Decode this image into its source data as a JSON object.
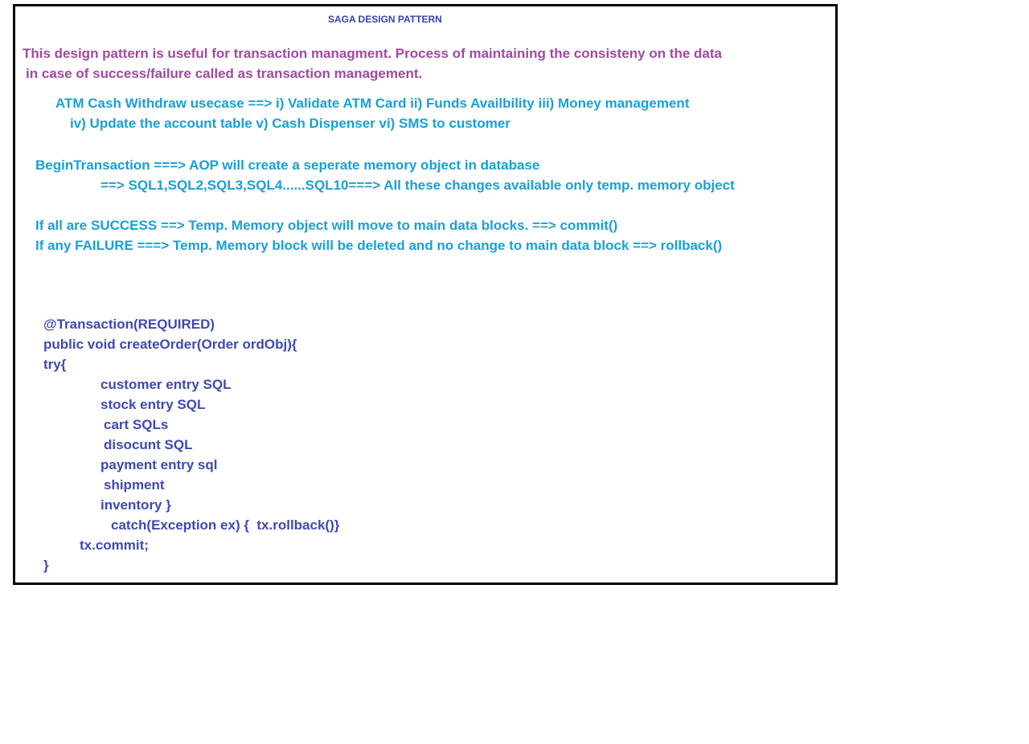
{
  "title": "SAGA DESIGN PATTERN",
  "intro": [
    "This design pattern is useful for transaction managment. Process of maintaining the consisteny on the data",
    "in case of success/failure called as transaction management."
  ],
  "usecase": [
    "ATM Cash Withdraw usecase ==> i) Validate ATM Card ii) Funds Availbility iii) Money management",
    "iv) Update the account table v) Cash Dispenser vi) SMS to customer"
  ],
  "transaction": [
    "BeginTransaction ===> AOP will create a seperate memory object in database",
    "==> SQL1,SQL2,SQL3,SQL4......SQL10===> All these changes available only temp. memory object"
  ],
  "outcomes": [
    "If all are SUCCESS ==> Temp. Memory object will move to main data blocks. ==> commit()",
    "If any FAILURE ===> Temp. Memory block will be deleted and no change to main data block ==> rollback()"
  ],
  "code": [
    "@Transaction(REQUIRED)",
    "public void createOrder(Order ordObj){",
    "try{",
    "customer entry SQL",
    "stock entry SQL",
    "cart SQLs",
    "disocunt SQL",
    "payment entry sql",
    "shipment",
    "inventory }",
    "catch(Exception ex) {  tx.rollback()}",
    "tx.commit;",
    "}"
  ],
  "colors": {
    "title": "#3b3fb0",
    "intro": "#a04a9e",
    "body": "#1a9fd6",
    "code": "#3e48b8",
    "border": "#000000"
  }
}
